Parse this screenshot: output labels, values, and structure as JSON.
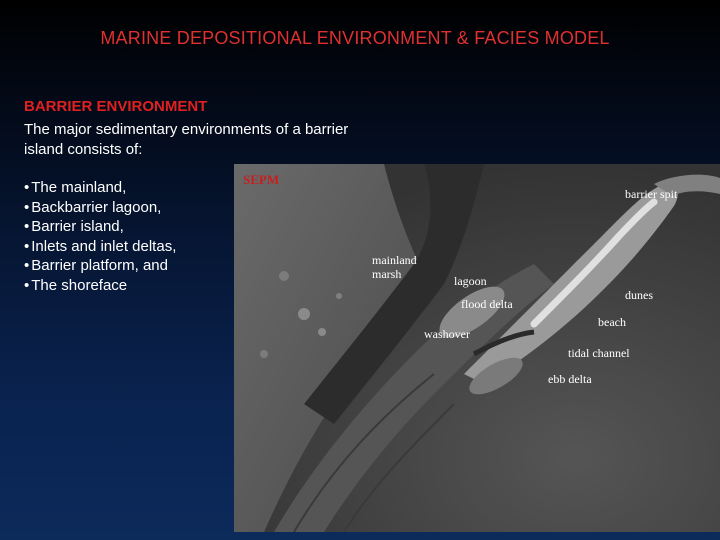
{
  "title": "MARINE DEPOSITIONAL ENVIRONMENT & FACIES MODEL",
  "section": {
    "heading": "BARRIER ENVIRONMENT",
    "intro": "The major sedimentary environments of a barrier island consists of:",
    "bullets": [
      "The mainland,",
      "Backbarrier lagoon,",
      "Barrier island,",
      "Inlets and inlet deltas,",
      "Barrier platform, and",
      "The shoreface"
    ]
  },
  "image": {
    "watermark": "SEPM",
    "labels": {
      "barrier_spit": "barrier spit",
      "mainland_marsh": [
        "mainland",
        "marsh"
      ],
      "lagoon": "lagoon",
      "flood_delta": "flood delta",
      "dunes": "dunes",
      "beach": "beach",
      "washover": "washover",
      "tidal_channel": "tidal channel",
      "ebb_delta": "ebb delta"
    }
  },
  "colors": {
    "title": "#e03030",
    "heading": "#e02020",
    "body_text": "#ffffff",
    "watermark": "#c81e1e"
  }
}
